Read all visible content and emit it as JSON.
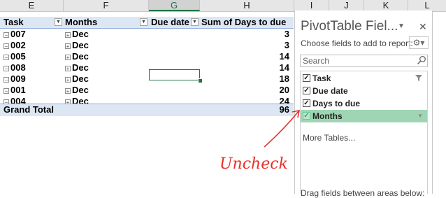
{
  "columns": [
    {
      "letter": "E",
      "selected": false
    },
    {
      "letter": "F",
      "selected": false
    },
    {
      "letter": "G",
      "selected": true
    },
    {
      "letter": "H",
      "selected": false
    },
    {
      "letter": "I",
      "selected": false
    },
    {
      "letter": "J",
      "selected": false
    },
    {
      "letter": "K",
      "selected": false
    },
    {
      "letter": "L",
      "selected": false
    }
  ],
  "pivot": {
    "headers": {
      "task": "Task",
      "months": "Months",
      "due_date": "Due date",
      "sum_days": "Sum of Days to due"
    },
    "rows": [
      {
        "task": "007",
        "month": "Dec",
        "value": "3"
      },
      {
        "task": "002",
        "month": "Dec",
        "value": "3"
      },
      {
        "task": "005",
        "month": "Dec",
        "value": "14"
      },
      {
        "task": "008",
        "month": "Dec",
        "value": "14"
      },
      {
        "task": "009",
        "month": "Dec",
        "value": "18"
      },
      {
        "task": "001",
        "month": "Dec",
        "value": "20"
      },
      {
        "task": "004",
        "month": "Dec",
        "value": "24"
      }
    ],
    "total_label": "Grand Total",
    "total_value": "96",
    "colors": {
      "header_fill": "#dde7f3",
      "border_blue": "#8eaadb",
      "selection_green": "#217346"
    }
  },
  "pane": {
    "title": "PivotTable Fiel...",
    "subtitle": "Choose fields to add to report:",
    "search_placeholder": "Search",
    "fields": [
      {
        "label": "Task",
        "checked": true,
        "highlighted": false,
        "icon": "filter-icon"
      },
      {
        "label": "Due date",
        "checked": true,
        "highlighted": false,
        "icon": ""
      },
      {
        "label": "Days to due",
        "checked": true,
        "highlighted": false,
        "icon": ""
      },
      {
        "label": "Months",
        "checked": true,
        "highlighted": true,
        "icon": "dropdown-arrow-icon"
      }
    ],
    "more_tables": "More Tables...",
    "footer": "Drag fields between areas below:",
    "highlight_color": "#9fd5b3"
  },
  "annotation": {
    "text": "Uncheck",
    "color": "#e8302a"
  }
}
